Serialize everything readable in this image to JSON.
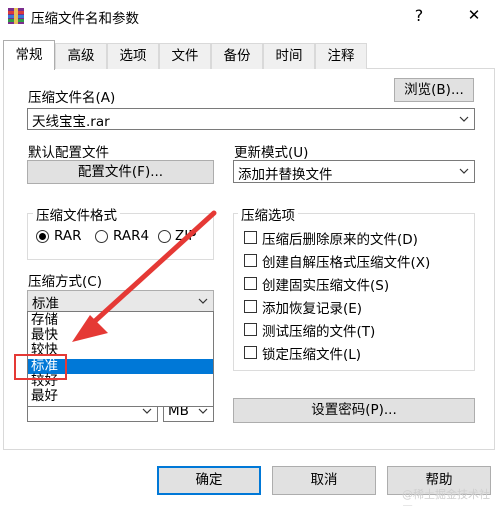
{
  "window": {
    "title": "压缩文件名和参数",
    "help_glyph": "?",
    "close_glyph": "✕"
  },
  "tabs": [
    {
      "label": "常规",
      "active": true
    },
    {
      "label": "高级"
    },
    {
      "label": "选项"
    },
    {
      "label": "文件"
    },
    {
      "label": "备份"
    },
    {
      "label": "时间"
    },
    {
      "label": "注释"
    }
  ],
  "general": {
    "archive_name_label": "压缩文件名(A)",
    "browse_button": "浏览(B)...",
    "archive_name_value": "天线宝宝.rar",
    "default_profile_label": "默认配置文件",
    "profile_button": "配置文件(F)...",
    "update_mode_label": "更新模式(U)",
    "update_mode_value": "添加并替换文件",
    "format_group_title": "压缩文件格式",
    "formats": [
      {
        "label": "RAR",
        "checked": true
      },
      {
        "label": "RAR4",
        "checked": false
      },
      {
        "label": "ZIP",
        "checked": false
      }
    ],
    "method_label": "压缩方式(C)",
    "method_value": "标准",
    "method_options": [
      "存储",
      "最快",
      "较快",
      "标准",
      "较好",
      "最好"
    ],
    "method_selected_index": 3,
    "split_unit": "MB",
    "options_group_title": "压缩选项",
    "options": [
      {
        "label": "压缩后删除原来的文件(D)",
        "checked": false
      },
      {
        "label": "创建自解压格式压缩文件(X)",
        "checked": false
      },
      {
        "label": "创建固实压缩文件(S)",
        "checked": false
      },
      {
        "label": "添加恢复记录(E)",
        "checked": false
      },
      {
        "label": "测试压缩的文件(T)",
        "checked": false
      },
      {
        "label": "锁定压缩文件(L)",
        "checked": false
      }
    ],
    "set_password_button": "设置密码(P)..."
  },
  "footer": {
    "ok_button": "确定",
    "cancel_button": "取消",
    "help_button": "帮助"
  },
  "colors": {
    "selection": "#0078d7",
    "annotation_red": "#e53935"
  },
  "watermark": "@稀土掘金技术社区"
}
